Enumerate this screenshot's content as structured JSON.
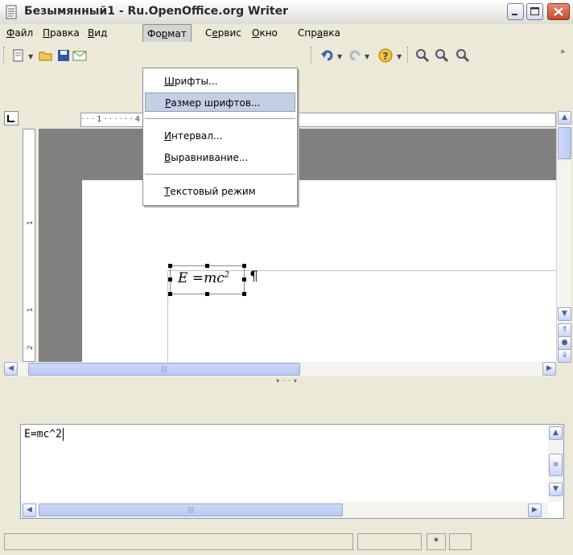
{
  "window": {
    "title": "Безымянный1 - Ru.OpenOffice.org Writer"
  },
  "menubar": {
    "items": [
      {
        "pre": "",
        "u": "Ф",
        "post": "айл"
      },
      {
        "pre": "",
        "u": "П",
        "post": "равка"
      },
      {
        "pre": "",
        "u": "В",
        "post": "ид"
      },
      {
        "pre": "Фо",
        "u": "р",
        "post": "мат"
      },
      {
        "pre": "С",
        "u": "е",
        "post": "рвис"
      },
      {
        "pre": "",
        "u": "О",
        "post": "кно"
      },
      {
        "pre": "Спр",
        "u": "а",
        "post": "вка"
      }
    ]
  },
  "format_menu": {
    "items": [
      {
        "pre": "",
        "u": "Ш",
        "post": "рифты..."
      },
      {
        "pre": "",
        "u": "Р",
        "post": "азмер шрифтов..."
      },
      {
        "pre": "",
        "u": "И",
        "post": "нтервал..."
      },
      {
        "pre": "",
        "u": "В",
        "post": "ыравнивание..."
      },
      {
        "pre": "",
        "u": "Т",
        "post": "екстовый режим"
      }
    ]
  },
  "ruler": {
    "ticks": "· · · 1 · · ·                    · · · 4 · · · 5 · · · 6 · · · 7 · · · 8 · · · 9"
  },
  "document": {
    "formula_E": "E",
    "formula_eq": " =",
    "formula_mc": "mc",
    "formula_sup": "2",
    "pilcrow": "¶"
  },
  "editor": {
    "text": "E=mc^2"
  },
  "statusbar": {
    "modified": "*"
  },
  "colors": {
    "menu_highlight": "#c5cfe4",
    "doc_background": "#808080",
    "close_button": "#c8452a"
  }
}
